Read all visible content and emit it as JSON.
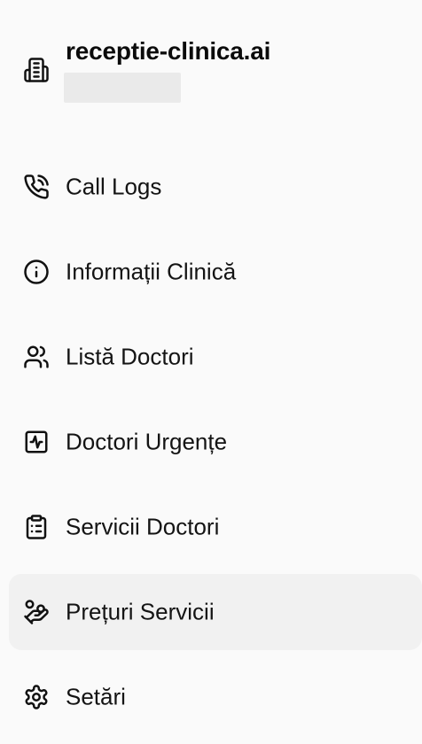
{
  "app": {
    "title": "receptie-clinica.ai",
    "logo_icon": "building-icon"
  },
  "nav": {
    "items": [
      {
        "label": "Call Logs",
        "icon": "phone-call-icon",
        "active": false
      },
      {
        "label": "Informații Clinică",
        "icon": "info-icon",
        "active": false
      },
      {
        "label": "Listă Doctori",
        "icon": "users-icon",
        "active": false
      },
      {
        "label": "Doctori Urgențe",
        "icon": "activity-square-icon",
        "active": false
      },
      {
        "label": "Servicii Doctori",
        "icon": "clipboard-list-icon",
        "active": false
      },
      {
        "label": "Prețuri Servicii",
        "icon": "hand-coins-icon",
        "active": true
      },
      {
        "label": "Setări",
        "icon": "gear-icon",
        "active": false
      }
    ]
  },
  "colors": {
    "background": "#fafafa",
    "active_item_bg": "#f1f1f1",
    "text": "#141414",
    "placeholder_block": "#eaeaea"
  }
}
